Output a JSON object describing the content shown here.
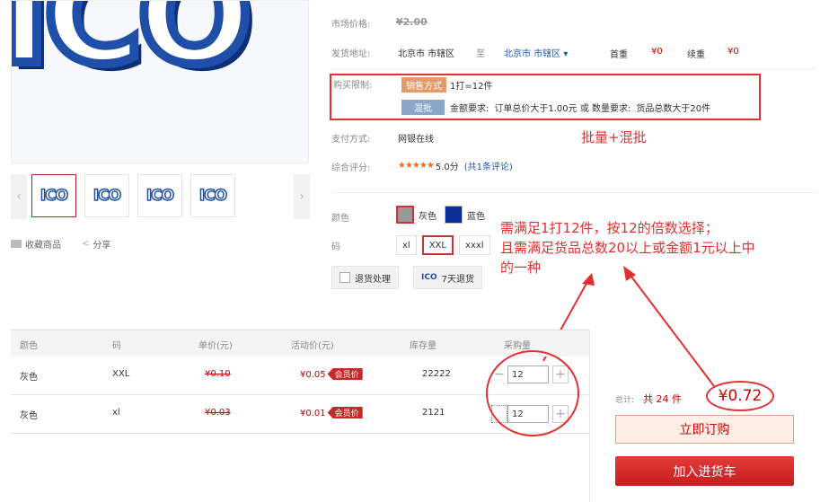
{
  "thumbs": [
    {
      "text": "ICO"
    },
    {
      "text": "ICO"
    },
    {
      "text": "ICO"
    },
    {
      "text": "ICO"
    }
  ],
  "big_logo_text": "ICO",
  "actions": {
    "favorite": "收藏商品",
    "share": "分享"
  },
  "market_price": {
    "label": "市场价格:",
    "value": "¥2.00"
  },
  "ship": {
    "label": "发货地址:",
    "from": "北京市 市辖区",
    "to_word": "至",
    "to": "北京市 市辖区",
    "first_label": "首重",
    "first_value": "¥0",
    "cont_label": "续重",
    "cont_value": "¥0"
  },
  "limit": {
    "label": "购买限制:",
    "tag1": "销售方式",
    "text1": "1打=12件",
    "tag2": "混批",
    "text2_a": "金额要求:",
    "text2_b": "订单总价大于1.00元 或 数量要求:",
    "text2_c": "货品总数大于20件"
  },
  "annot_batch": "批量+混批",
  "payment": {
    "label": "支付方式:",
    "value": "网银在线"
  },
  "rating": {
    "label": "综合评分:",
    "stars": "★★★★★",
    "score": "5.0分",
    "reviews": "(共1条评论)"
  },
  "color": {
    "label": "颜色",
    "options": [
      {
        "name": "灰色",
        "hex": "#999999"
      },
      {
        "name": "蓝色",
        "hex": "#0a2f96"
      }
    ]
  },
  "size": {
    "label": "码",
    "options": [
      "xl",
      "XXL",
      "xxxl"
    ]
  },
  "services": {
    "returns": "退货处理",
    "seven_day": "7天退货",
    "ico": "ICO"
  },
  "annotation": {
    "line1": "需满足1打12件，按12的倍数选择；",
    "line2": "且需满足货品总数20以上或金额1元以上中",
    "line3": "的一种"
  },
  "table": {
    "headers": [
      "颜色",
      "码",
      "单价(元)",
      "活动价(元)",
      "库存量",
      "采购量"
    ],
    "rows": [
      {
        "color": "灰色",
        "size": "XXL",
        "price": "¥0.10",
        "promo": "¥0.05",
        "vip": "会员价",
        "stock": "22222",
        "qty": "12"
      },
      {
        "color": "灰色",
        "size": "xl",
        "price": "¥0.03",
        "promo": "¥0.01",
        "vip": "会员价",
        "stock": "2121",
        "qty": "12"
      }
    ]
  },
  "summary": {
    "total_label": "总计:",
    "total_count": "共 24 件",
    "total_price": "¥0.72"
  },
  "buttons": {
    "order": "立即订购",
    "cart": "加入进货车"
  }
}
